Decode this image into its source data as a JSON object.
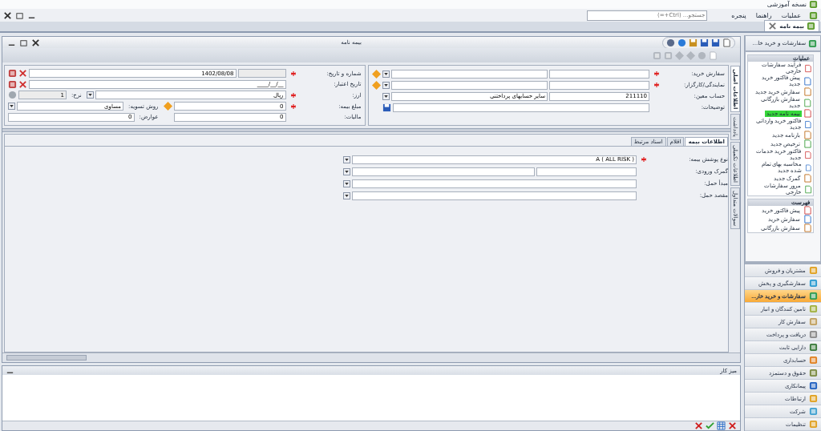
{
  "app_title": "نسخه آموزشی",
  "menu": [
    "عملیات",
    "راهنما",
    "پنجره"
  ],
  "search": {
    "placeholder": "جستجو... (Ctrl+=)"
  },
  "doc_tabs": [
    {
      "label": "بیمه نامه",
      "selected": true
    }
  ],
  "form_window": {
    "title": "بیمه نامه"
  },
  "side_tabs": [
    {
      "label": "اطلاعات اصلی",
      "selected": true
    },
    {
      "label": "یادداشت",
      "selected": false
    },
    {
      "label": "اطلاعات تکمیلی",
      "selected": false
    },
    {
      "label": "سوالات متداول",
      "selected": false
    }
  ],
  "order_fields": [
    {
      "label": "سفارش خرید:",
      "required": true,
      "kind": "lookup"
    },
    {
      "label": "نمایندگی/کارگزار:",
      "required": true,
      "kind": "lookup"
    },
    {
      "label": "حساب معین:",
      "required": false,
      "kind": "account",
      "code": "211110",
      "name": "سایر حسابهای پرداختنی"
    },
    {
      "label": "توضیحات:",
      "required": false,
      "kind": "text"
    }
  ],
  "header_fields": {
    "number_date": {
      "label": "شماره و تاریخ:",
      "required": true,
      "date": "1402/08/08"
    },
    "valid_date": {
      "label": "تاریخ اعتبار:",
      "required": false,
      "date": "____/__/__"
    },
    "currency": {
      "label": "ارز:",
      "required": true,
      "value": "ریال",
      "rate_label": "نرخ:",
      "rate": "1"
    },
    "amount": {
      "label": "مبلغ بیمه:",
      "required": true,
      "value": "0",
      "settle_label": "روش تسویه:",
      "settle": "مساوی"
    },
    "tax": {
      "label": "مالیات:",
      "value": "0",
      "duties_label": "عوارض:",
      "duties": "0"
    }
  },
  "detail_tabs": [
    {
      "label": "اطلاعات بیمه",
      "selected": true
    },
    {
      "label": "اقلام",
      "selected": false
    },
    {
      "label": "اسناد مرتبط",
      "selected": false
    }
  ],
  "insurance_fields": [
    {
      "label": "نوع پوشش بیمه:",
      "required": true,
      "kind": "combo",
      "value": "A ( ALL RISK )"
    },
    {
      "label": "گمرک ورودی:",
      "required": false,
      "kind": "split"
    },
    {
      "label": "مبدأ حمل:",
      "required": false,
      "kind": "combo"
    },
    {
      "label": "مقصد حمل:",
      "required": false,
      "kind": "combo"
    }
  ],
  "desk": {
    "title": "میز کار"
  },
  "sidebar": {
    "header": "سفارشات و خرید خا...",
    "groups": [
      {
        "title": "عملیات",
        "items": [
          {
            "label": "فرآیند سفارشات خارجی",
            "selected": false
          },
          {
            "label": "پیش فاکتور خرید جدید",
            "selected": false
          },
          {
            "label": "سفارش خرید جدید",
            "selected": false
          },
          {
            "label": "سفارش بازرگانی جدید",
            "selected": false
          },
          {
            "label": "بیمه نامه جدید",
            "selected": true
          },
          {
            "label": "فاکتور خرید وارداتی جدید",
            "selected": false
          },
          {
            "label": "بارنامه جدید",
            "selected": false
          },
          {
            "label": "ترخیص جدید",
            "selected": false
          },
          {
            "label": "فاکتور خرید خدمات جدید",
            "selected": false
          },
          {
            "label": "محاسبه بهای تمام شده جدید",
            "selected": false
          },
          {
            "label": "گمرک جدید",
            "selected": false
          },
          {
            "label": "مرور سفارشات خارجی",
            "selected": false
          }
        ]
      },
      {
        "title": "فهرست",
        "items": [
          {
            "label": "پیش فاکتور خرید",
            "selected": false
          },
          {
            "label": "سفارش خرید",
            "selected": false
          },
          {
            "label": "سفارش بازرگانی",
            "selected": false
          }
        ]
      }
    ],
    "modules": [
      {
        "label": "مشتریان و فروش",
        "selected": false
      },
      {
        "label": "سفارشگیری و پخش",
        "selected": false
      },
      {
        "label": "سفارشات و خرید خار...",
        "selected": true
      },
      {
        "label": "تامین کنندگان و انبار",
        "selected": false
      },
      {
        "label": "سفارش کار",
        "selected": false
      },
      {
        "label": "دریافت و پرداخت",
        "selected": false
      },
      {
        "label": "دارایی ثابت",
        "selected": false
      },
      {
        "label": "حسابداری",
        "selected": false
      },
      {
        "label": "حقوق و دستمزد",
        "selected": false
      },
      {
        "label": "پیمانکاری",
        "selected": false
      },
      {
        "label": "ارتباطات",
        "selected": false
      },
      {
        "label": "شرکت",
        "selected": false
      },
      {
        "label": "تنظیمات",
        "selected": false
      }
    ]
  }
}
